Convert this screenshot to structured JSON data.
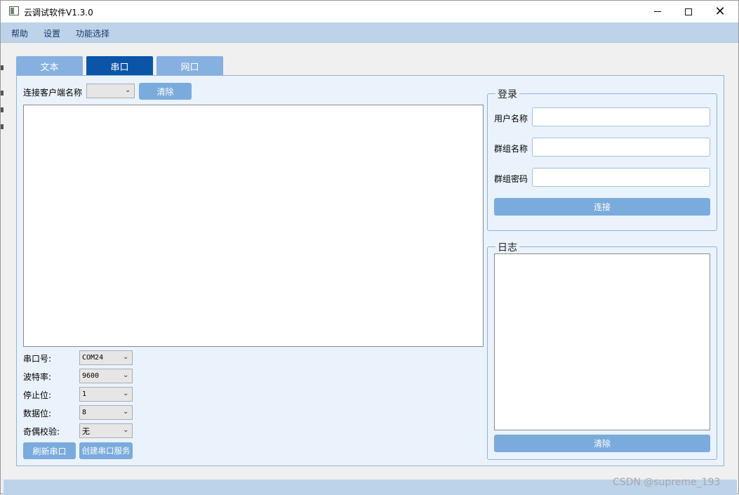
{
  "window": {
    "title": "云调试软件V1.3.0"
  },
  "menu": {
    "items": [
      "帮助",
      "设置",
      "功能选择"
    ]
  },
  "tabs": {
    "items": [
      "文本",
      "串口",
      "网口"
    ],
    "active": "串口"
  },
  "serial": {
    "client_label": "连接客户端名称",
    "client_value": "",
    "clear_label": "清除",
    "port_label": "串口号:",
    "port_value": "COM24",
    "baud_label": "波特率:",
    "baud_value": "9600",
    "stopbits_label": "停止位:",
    "stopbits_value": "1",
    "databits_label": "数据位:",
    "databits_value": "8",
    "parity_label": "奇偶校验:",
    "parity_value": "无",
    "refresh_label": "刷新串口",
    "create_label": "创建串口服务"
  },
  "login": {
    "title": "登录",
    "username_label": "用户名称",
    "group_label": "群组名称",
    "password_label": "群组密码",
    "connect_label": "连接"
  },
  "log": {
    "title": "日志",
    "clear_label": "清除"
  },
  "watermark": "CSDN @supreme_193"
}
